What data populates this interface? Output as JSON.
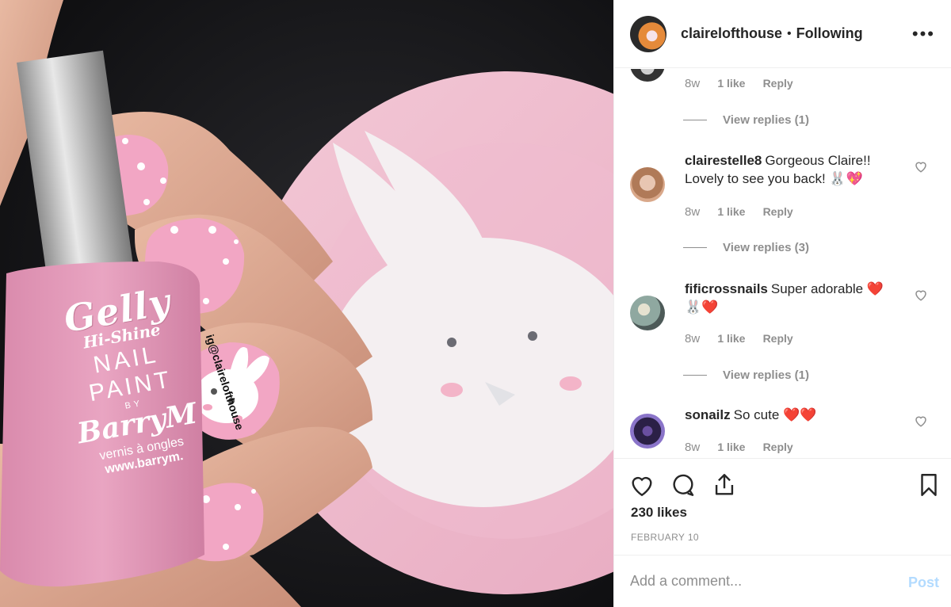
{
  "photo": {
    "description_icon": "photo",
    "bottle": {
      "line1": "Gelly",
      "line2": "Hi-Shine",
      "line3": "NAIL",
      "line4": "PAINT",
      "line5": "BY",
      "line6": "BarryM",
      "line7": "vernis à ongles",
      "line8": "www.barrym."
    },
    "watermark": "ig@clairelofthouse"
  },
  "header": {
    "username": "clairelofthouse",
    "separator": "•",
    "following": "Following",
    "more": "•••"
  },
  "comments": [
    {
      "time": "8w",
      "likes": "1 like",
      "reply": "Reply",
      "view_replies": "View replies (1)"
    },
    {
      "user": "clairestelle8",
      "text": "Gorgeous Claire!! Lovely to see you back! 🐰💖",
      "time": "8w",
      "likes": "1 like",
      "reply": "Reply",
      "view_replies": "View replies (3)"
    },
    {
      "user": "fificrossnails",
      "text": "Super adorable ❤️ 🐰❤️",
      "time": "8w",
      "likes": "1 like",
      "reply": "Reply",
      "view_replies": "View replies (1)"
    },
    {
      "user": "sonailz",
      "text": "So cute ❤️❤️",
      "time": "8w",
      "likes": "1 like",
      "reply": "Reply"
    }
  ],
  "actions": {
    "likes": "230 likes",
    "date": "FEBRUARY 10"
  },
  "add_comment": {
    "placeholder": "Add a comment...",
    "post": "Post"
  },
  "colors": {
    "link_disabled": "#b3dbff",
    "muted": "#8e8e8e",
    "text": "#262626",
    "nail_pink": "#f2a6c4"
  }
}
